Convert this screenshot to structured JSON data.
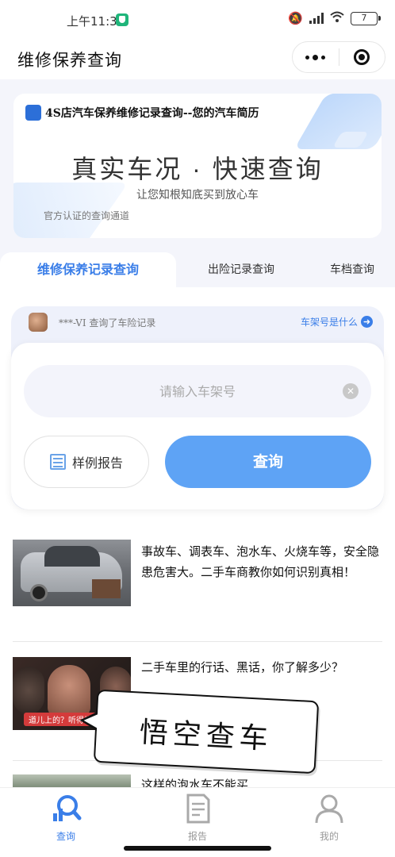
{
  "status_bar": {
    "time": "上午11:38",
    "battery": "7"
  },
  "nav": {
    "title": "维修保养查询"
  },
  "banner": {
    "logo_text": "汽车简历",
    "headline": "4S店汽车保养维修记录查询--您的汽车简历",
    "title": "真实车况 · 快速查询",
    "subtitle": "让您知根知底买到放心车",
    "caption": "官方认证的查询通道"
  },
  "tabs": [
    {
      "label": "维修保养记录查询",
      "active": true
    },
    {
      "label": "出险记录查询",
      "active": false
    },
    {
      "label": "车档查询",
      "active": false
    }
  ],
  "notice": {
    "text": "***-VI  查询了车险记录",
    "link": "车架号是什么"
  },
  "query": {
    "placeholder": "请输入车架号",
    "value": "",
    "sample_label": "样例报告",
    "submit_label": "查询"
  },
  "articles": [
    {
      "title": "事故车、调表车、泡水车、火烧车等，安全隐患危害大。二手车商教你如何识别真相！"
    },
    {
      "title": "二手车里的行话、黑话，你了解多少？",
      "thumb_caption": "道儿上的？听得懂"
    },
    {
      "title": "这样的泡水车不能买"
    }
  ],
  "sticker": {
    "text": "悟空查车"
  },
  "tabbar": [
    {
      "label": "查询",
      "active": true
    },
    {
      "label": "报告",
      "active": false
    },
    {
      "label": "我的",
      "active": false
    }
  ],
  "colors": {
    "accent": "#3a7ee8",
    "button": "#5ea3f5",
    "page_bg": "#f4f5fb"
  }
}
